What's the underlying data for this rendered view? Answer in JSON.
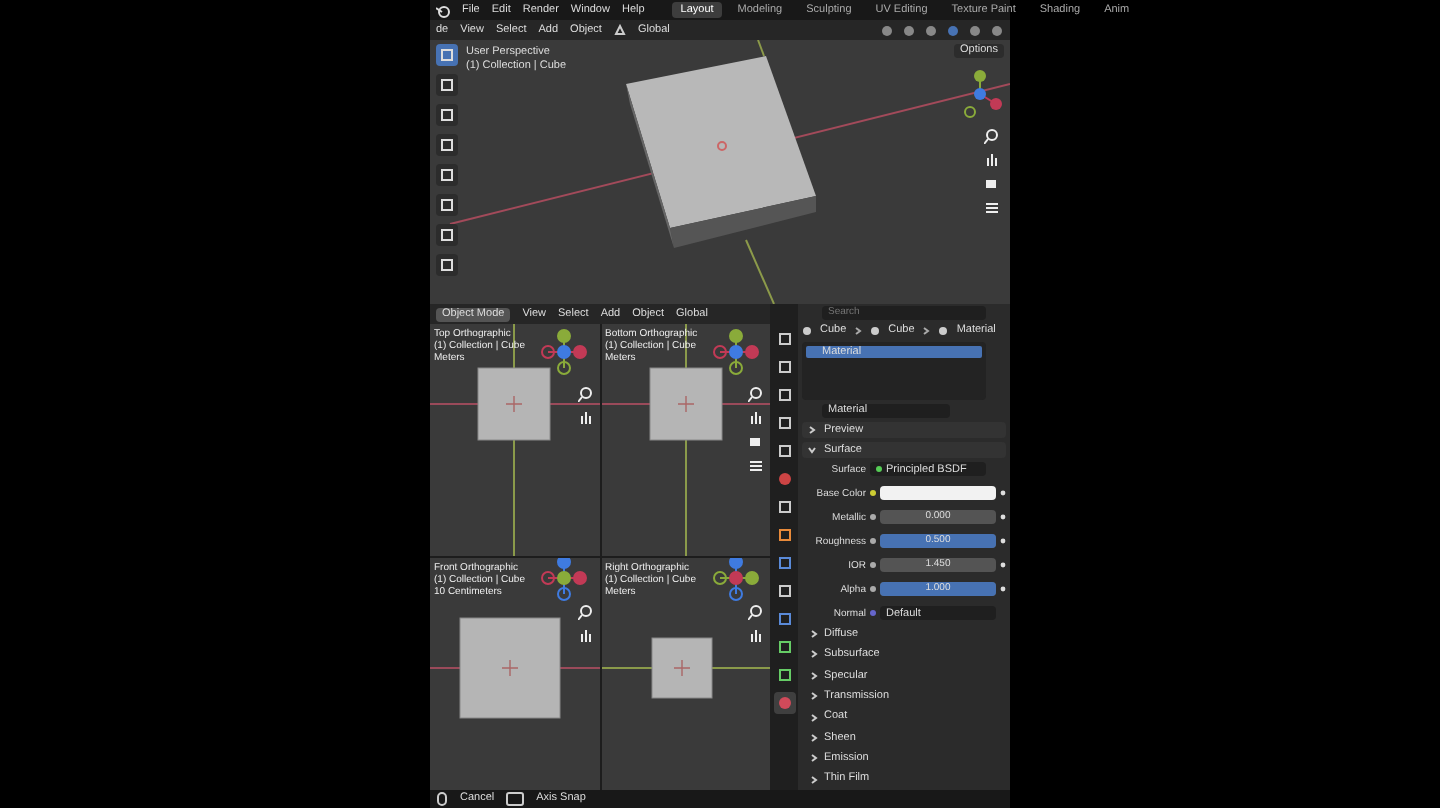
{
  "topbar": {
    "menus": [
      "File",
      "Edit",
      "Render",
      "Window",
      "Help"
    ],
    "workspaces": [
      {
        "label": "Layout",
        "selected": true
      },
      {
        "label": "Modeling",
        "selected": false
      },
      {
        "label": "Sculpting",
        "selected": false
      },
      {
        "label": "UV Editing",
        "selected": false
      },
      {
        "label": "Texture Paint",
        "selected": false
      },
      {
        "label": "Shading",
        "selected": false
      },
      {
        "label": "Anim",
        "selected": false
      }
    ]
  },
  "viewport_header": {
    "mode": "de",
    "menus": [
      "View",
      "Select",
      "Add",
      "Object"
    ],
    "orientation": "Global"
  },
  "viewport": {
    "lines": [
      "User Perspective",
      "(1) Collection | Cube"
    ],
    "options": "Options"
  },
  "quad_header": {
    "mode": "Object Mode",
    "menus": [
      "View",
      "Select",
      "Add",
      "Object"
    ],
    "orientation": "Global"
  },
  "quad_views": [
    {
      "kind": "top",
      "lines": [
        "Top Orthographic",
        "(1) Collection | Cube",
        "Meters"
      ],
      "camera_controls": false
    },
    {
      "kind": "bottom",
      "lines": [
        "Bottom Orthographic",
        "(1) Collection | Cube",
        "Meters"
      ],
      "camera_controls": true
    },
    {
      "kind": "front",
      "lines": [
        "Front Orthographic",
        "(1) Collection | Cube",
        "10 Centimeters"
      ],
      "camera_controls": false
    },
    {
      "kind": "right",
      "lines": [
        "Right Orthographic",
        "(1) Collection | Cube",
        "Meters"
      ],
      "camera_controls": false
    }
  ],
  "properties": {
    "search_placeholder": "Search",
    "tabs": [
      {
        "kind": "tool",
        "selected": false
      },
      {
        "kind": "render",
        "selected": false
      },
      {
        "kind": "output",
        "selected": false
      },
      {
        "kind": "view",
        "selected": false
      },
      {
        "kind": "scene",
        "selected": false
      },
      {
        "kind": "world",
        "selected": false
      },
      {
        "kind": "collection",
        "selected": false
      },
      {
        "kind": "object",
        "selected": false
      },
      {
        "kind": "modifier",
        "selected": false
      },
      {
        "kind": "particles",
        "selected": false
      },
      {
        "kind": "physics",
        "selected": false
      },
      {
        "kind": "data",
        "selected": false
      },
      {
        "kind": "mesh",
        "selected": false
      },
      {
        "kind": "material",
        "selected": true
      }
    ],
    "breadcrumb": [
      "Cube",
      "Cube",
      "Material"
    ],
    "slots": [
      {
        "label": "Material",
        "selected": true
      }
    ],
    "material_name": "Material",
    "panels": [
      {
        "label": "Preview",
        "expanded": false
      },
      {
        "label": "Surface",
        "expanded": true
      }
    ],
    "surface": {
      "label": "Surface",
      "value": "Principled BSDF"
    },
    "fields": [
      {
        "kind": "color",
        "label": "Base Color"
      },
      {
        "kind": "slider",
        "label": "Metallic",
        "value": "0.000",
        "level": 0
      },
      {
        "kind": "slider",
        "label": "Roughness",
        "value": "0.500",
        "level": 1
      },
      {
        "kind": "slider",
        "label": "IOR",
        "value": "1.450",
        "level": 0
      },
      {
        "kind": "slider",
        "label": "Alpha",
        "value": "1.000",
        "level": 1
      },
      {
        "kind": "link",
        "label": "Normal",
        "value": "Default"
      }
    ],
    "sections": [
      {
        "label": "Diffuse",
        "expanded": false
      },
      {
        "label": "Subsurface",
        "expanded": false
      },
      {
        "label": "Specular",
        "expanded": false
      },
      {
        "label": "Transmission",
        "expanded": false
      },
      {
        "label": "Coat",
        "expanded": false
      },
      {
        "label": "Sheen",
        "expanded": false
      },
      {
        "label": "Emission",
        "expanded": false
      },
      {
        "label": "Thin Film",
        "expanded": false
      }
    ]
  },
  "status_bar": [
    {
      "kind": "mouse",
      "label": "Cancel"
    },
    {
      "kind": "key",
      "label": "Axis Snap"
    }
  ]
}
